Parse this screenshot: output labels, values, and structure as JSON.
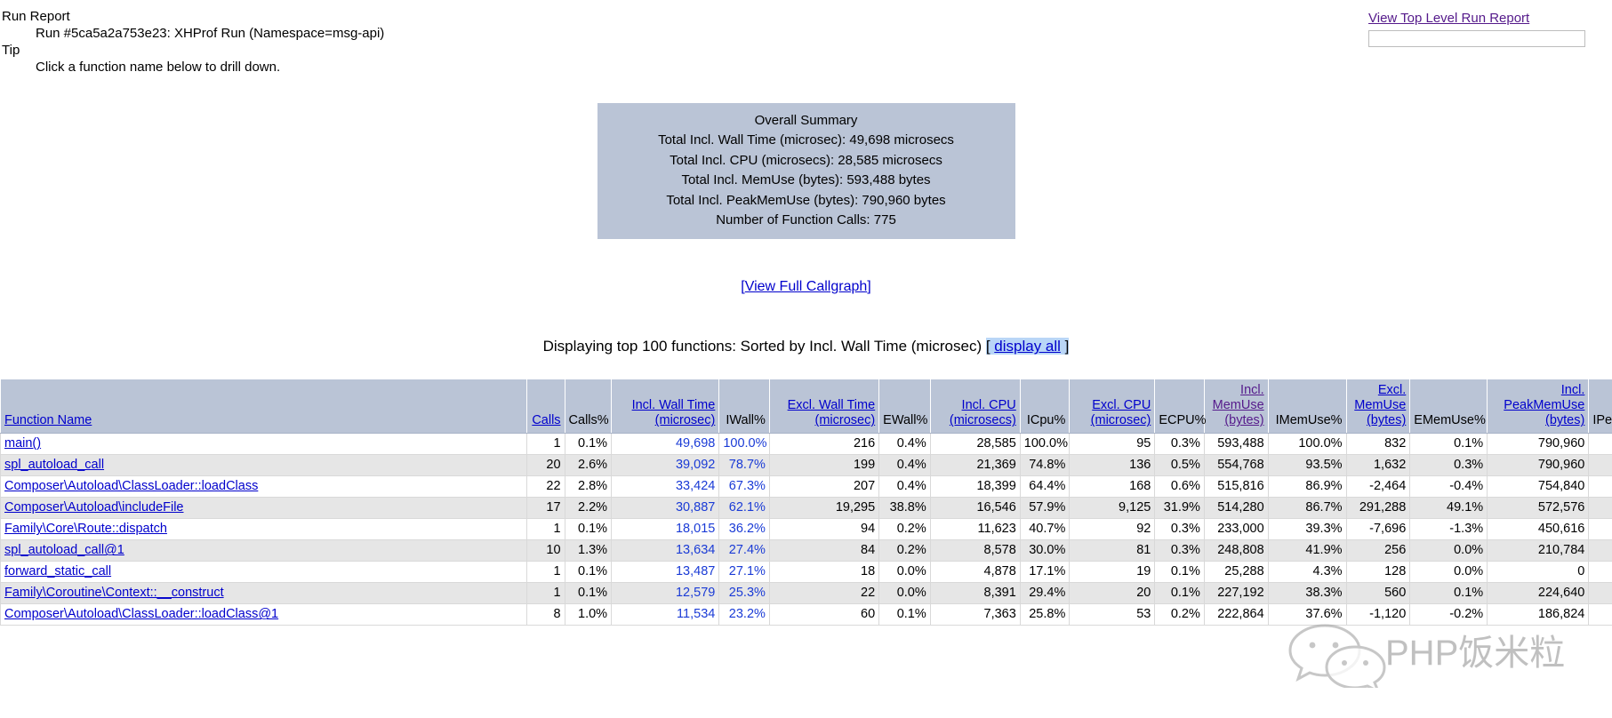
{
  "header": {
    "report_label": "Run Report",
    "run_line": "Run #5ca5a2a753e23: XHProf Run (Namespace=msg-api)",
    "tip_label": "Tip",
    "tip_text": "Click a function name below to drill down.",
    "top_level_link": "View Top Level Run Report",
    "run_input_value": "",
    "run_input_placeholder": ""
  },
  "summary": {
    "title": "Overall Summary",
    "rows": [
      "Total Incl. Wall Time (microsec): 49,698 microsecs",
      "Total Incl. CPU (microsecs): 28,585 microsecs",
      "Total Incl. MemUse (bytes): 593,488 bytes",
      "Total Incl. PeakMemUse (bytes): 790,960 bytes",
      "Number of Function Calls: 775"
    ]
  },
  "callgraph": {
    "open_bracket": "[",
    "link": "View Full Callgraph",
    "close_bracket": "]"
  },
  "displaying": {
    "prefix": "Displaying top 100 functions: Sorted by Incl. Wall Time (microsec) ",
    "open_bracket": "[ ",
    "link": "display all",
    "close_bracket": " ]"
  },
  "table": {
    "columns": [
      {
        "label": "Function Name",
        "link": true,
        "visited": false,
        "align": "left"
      },
      {
        "label": "Calls",
        "link": true,
        "visited": false,
        "align": "right"
      },
      {
        "label": "Calls%",
        "link": false,
        "visited": false,
        "align": "right"
      },
      {
        "label": "Incl. Wall Time (microsec)",
        "link": true,
        "visited": false,
        "align": "right"
      },
      {
        "label": "IWall%",
        "link": false,
        "visited": false,
        "align": "right"
      },
      {
        "label": "Excl. Wall Time (microsec)",
        "link": true,
        "visited": false,
        "align": "right"
      },
      {
        "label": "EWall%",
        "link": false,
        "visited": false,
        "align": "right"
      },
      {
        "label": "Incl. CPU (microsecs)",
        "link": true,
        "visited": false,
        "align": "right"
      },
      {
        "label": "ICpu%",
        "link": false,
        "visited": false,
        "align": "right"
      },
      {
        "label": "Excl. CPU (microsec)",
        "link": true,
        "visited": false,
        "align": "right"
      },
      {
        "label": "ECPU%",
        "link": false,
        "visited": false,
        "align": "right"
      },
      {
        "label": "Incl. MemUse (bytes)",
        "link": true,
        "visited": true,
        "align": "right"
      },
      {
        "label": "IMemUse%",
        "link": false,
        "visited": false,
        "align": "right"
      },
      {
        "label": "Excl. MemUse (bytes)",
        "link": true,
        "visited": false,
        "align": "right"
      },
      {
        "label": "EMemUse%",
        "link": false,
        "visited": false,
        "align": "right"
      },
      {
        "label": "Incl. PeakMemUse (bytes)",
        "link": true,
        "visited": false,
        "align": "right"
      },
      {
        "label": "IPe",
        "link": false,
        "visited": false,
        "align": "left"
      }
    ],
    "sorted_column_index": 3,
    "rows": [
      {
        "function": "main()",
        "calls": "1",
        "calls_pct": "0.1%",
        "incl_wall": "49,698",
        "iwall_pct": "100.0%",
        "excl_wall": "216",
        "ewall_pct": "0.4%",
        "incl_cpu": "28,585",
        "icpu_pct": "100.0%",
        "excl_cpu": "95",
        "ecpu_pct": "0.3%",
        "incl_mem": "593,488",
        "imem_pct": "100.0%",
        "excl_mem": "832",
        "emem_pct": "0.1%",
        "incl_peak": "790,960",
        "ipeak_pct": ""
      },
      {
        "function": "spl_autoload_call",
        "calls": "20",
        "calls_pct": "2.6%",
        "incl_wall": "39,092",
        "iwall_pct": "78.7%",
        "excl_wall": "199",
        "ewall_pct": "0.4%",
        "incl_cpu": "21,369",
        "icpu_pct": "74.8%",
        "excl_cpu": "136",
        "ecpu_pct": "0.5%",
        "incl_mem": "554,768",
        "imem_pct": "93.5%",
        "excl_mem": "1,632",
        "emem_pct": "0.3%",
        "incl_peak": "790,960",
        "ipeak_pct": ""
      },
      {
        "function": "Composer\\Autoload\\ClassLoader::loadClass",
        "calls": "22",
        "calls_pct": "2.8%",
        "incl_wall": "33,424",
        "iwall_pct": "67.3%",
        "excl_wall": "207",
        "ewall_pct": "0.4%",
        "incl_cpu": "18,399",
        "icpu_pct": "64.4%",
        "excl_cpu": "168",
        "ecpu_pct": "0.6%",
        "incl_mem": "515,816",
        "imem_pct": "86.9%",
        "excl_mem": "-2,464",
        "emem_pct": "-0.4%",
        "incl_peak": "754,840",
        "ipeak_pct": ""
      },
      {
        "function": "Composer\\Autoload\\includeFile",
        "calls": "17",
        "calls_pct": "2.2%",
        "incl_wall": "30,887",
        "iwall_pct": "62.1%",
        "excl_wall": "19,295",
        "ewall_pct": "38.8%",
        "incl_cpu": "16,546",
        "icpu_pct": "57.9%",
        "excl_cpu": "9,125",
        "ecpu_pct": "31.9%",
        "incl_mem": "514,280",
        "imem_pct": "86.7%",
        "excl_mem": "291,288",
        "emem_pct": "49.1%",
        "incl_peak": "572,576",
        "ipeak_pct": ""
      },
      {
        "function": "Family\\Core\\Route::dispatch",
        "calls": "1",
        "calls_pct": "0.1%",
        "incl_wall": "18,015",
        "iwall_pct": "36.2%",
        "excl_wall": "94",
        "ewall_pct": "0.2%",
        "incl_cpu": "11,623",
        "icpu_pct": "40.7%",
        "excl_cpu": "92",
        "ecpu_pct": "0.3%",
        "incl_mem": "233,000",
        "imem_pct": "39.3%",
        "excl_mem": "-7,696",
        "emem_pct": "-1.3%",
        "incl_peak": "450,616",
        "ipeak_pct": ""
      },
      {
        "function": "spl_autoload_call@1",
        "calls": "10",
        "calls_pct": "1.3%",
        "incl_wall": "13,634",
        "iwall_pct": "27.4%",
        "excl_wall": "84",
        "ewall_pct": "0.2%",
        "incl_cpu": "8,578",
        "icpu_pct": "30.0%",
        "excl_cpu": "81",
        "ecpu_pct": "0.3%",
        "incl_mem": "248,808",
        "imem_pct": "41.9%",
        "excl_mem": "256",
        "emem_pct": "0.0%",
        "incl_peak": "210,784",
        "ipeak_pct": ""
      },
      {
        "function": "forward_static_call",
        "calls": "1",
        "calls_pct": "0.1%",
        "incl_wall": "13,487",
        "iwall_pct": "27.1%",
        "excl_wall": "18",
        "ewall_pct": "0.0%",
        "incl_cpu": "4,878",
        "icpu_pct": "17.1%",
        "excl_cpu": "19",
        "ecpu_pct": "0.1%",
        "incl_mem": "25,288",
        "imem_pct": "4.3%",
        "excl_mem": "128",
        "emem_pct": "0.0%",
        "incl_peak": "0",
        "ipeak_pct": ""
      },
      {
        "function": "Family\\Coroutine\\Context::__construct",
        "calls": "1",
        "calls_pct": "0.1%",
        "incl_wall": "12,579",
        "iwall_pct": "25.3%",
        "excl_wall": "22",
        "ewall_pct": "0.0%",
        "incl_cpu": "8,391",
        "icpu_pct": "29.4%",
        "excl_cpu": "20",
        "ecpu_pct": "0.1%",
        "incl_mem": "227,192",
        "imem_pct": "38.3%",
        "excl_mem": "560",
        "emem_pct": "0.1%",
        "incl_peak": "224,640",
        "ipeak_pct": ""
      },
      {
        "function": "Composer\\Autoload\\ClassLoader::loadClass@1",
        "calls": "8",
        "calls_pct": "1.0%",
        "incl_wall": "11,534",
        "iwall_pct": "23.2%",
        "excl_wall": "60",
        "ewall_pct": "0.1%",
        "incl_cpu": "7,363",
        "icpu_pct": "25.8%",
        "excl_cpu": "53",
        "ecpu_pct": "0.2%",
        "incl_mem": "222,864",
        "imem_pct": "37.6%",
        "excl_mem": "-1,120",
        "emem_pct": "-0.2%",
        "incl_peak": "186,824",
        "ipeak_pct": ""
      }
    ]
  },
  "watermark": {
    "text": "PHP饭米粒"
  },
  "colors": {
    "summary_bg": "#bac4d6",
    "header_bg": "#bac4d6",
    "link": "#0000cc",
    "visited_link": "#551a8b",
    "sorted_value": "#1a3bd6",
    "row_alt_bg": "#e6e6e6",
    "selection_bg": "#b9d6f7"
  }
}
